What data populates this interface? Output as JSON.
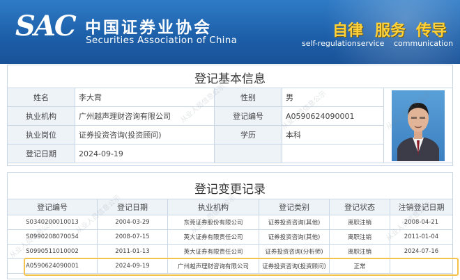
{
  "header": {
    "logo_abbr": "SAC",
    "org_name_cn": "中国证券业协会",
    "org_name_en": "Securities Association of China",
    "motto": [
      {
        "cn": "自律",
        "en": "self-regulation"
      },
      {
        "cn": "服务",
        "en": "service"
      },
      {
        "cn": "传导",
        "en": "communication"
      }
    ]
  },
  "basic_info": {
    "title": "登记基本信息",
    "name_label": "姓名",
    "name": "李大霄",
    "gender_label": "性别",
    "gender": "男",
    "institution_label": "执业机构",
    "institution": "广州越声理财咨询有限公司",
    "reg_no_label": "登记编号",
    "reg_no": "A0590624090001",
    "position_label": "执业岗位",
    "position": "证券投资咨询(投资顾问)",
    "education_label": "学历",
    "education": "本科",
    "reg_date_label": "登记日期",
    "reg_date": "2024-09-19"
  },
  "history": {
    "title": "登记变更记录",
    "columns": [
      "登记编号",
      "登记日期",
      "执业机构",
      "登记类别",
      "登记状态",
      "注销登记日期"
    ],
    "rows": [
      [
        "S0340200010013",
        "2004-03-29",
        "东莞证券股份有限公司",
        "证券投资咨询(其他)",
        "离职注销",
        "2008-04-21"
      ],
      [
        "S0990208070054",
        "2008-07-15",
        "英大证券有限责任公司",
        "证券投资咨询(其他)",
        "离职注销",
        "2011-01-04"
      ],
      [
        "S0990511010002",
        "2011-01-13",
        "英大证券有限责任公司",
        "证券投资咨询(分析师)",
        "离职注销",
        "2024-07-16"
      ],
      [
        "A0590624090001",
        "2024-09-19",
        "广州越声理财咨询有限公司",
        "证券投资咨询(投资顾问)",
        "正常",
        ""
      ]
    ]
  },
  "watermark": "从业人员信息公示",
  "colors": {
    "banner": "#1c5ea8",
    "motto": "#ffd23a",
    "highlight": "#f5c24a",
    "label_bg": "#eef3f8"
  }
}
